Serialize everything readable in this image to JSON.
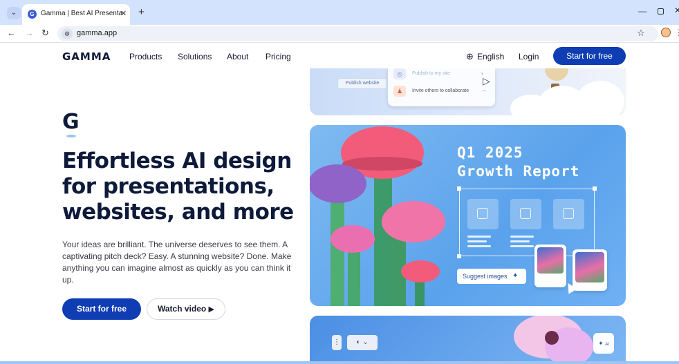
{
  "browser": {
    "tab_title": "Gamma | Best AI Presentation Maker",
    "url": "gamma.app",
    "icons": {
      "tab_list": "chevron-down-icon",
      "favicon": "gamma-favicon",
      "close": "close-icon",
      "new_tab": "plus-icon",
      "back": "back-arrow-icon",
      "forward": "forward-arrow-icon",
      "reload": "reload-icon",
      "site_info": "site-info-icon",
      "bookmark": "star-icon",
      "profile": "profile-avatar",
      "menu": "kebab-menu-icon"
    }
  },
  "site_header": {
    "logo": "GAMMA",
    "nav": [
      "Products",
      "Solutions",
      "About",
      "Pricing"
    ],
    "language": "English",
    "login": "Login",
    "cta": "Start for free"
  },
  "hero": {
    "mark": "G",
    "headline": "Effortless AI design for presentations, websites, and more",
    "subcopy": "Your ideas are brilliant. The universe deserves to see them. A captivating pitch deck? Easy. A stunning website? Done. Make anything you can imagine almost as quickly as you can think it up.",
    "primary_button": "Start for free",
    "secondary_button": "Watch video"
  },
  "showcase": {
    "publish_chip": "Publish website",
    "menu_items": [
      "Publish to my site",
      "Invite others to collaborate"
    ],
    "report_title_line1": "Q1 2025",
    "report_title_line2": "Growth Report",
    "suggest_chip": "Suggest images",
    "ai_button": "AI"
  },
  "colors": {
    "brand_dark": "#0e1a3a",
    "brand_blue": "#0f3db3",
    "card_blue": "#5aa2ec"
  }
}
